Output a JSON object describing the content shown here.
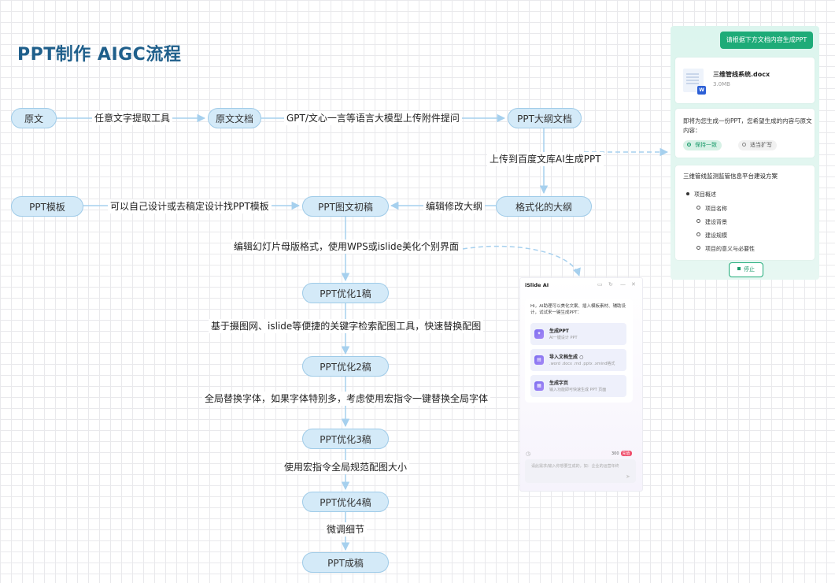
{
  "title": "PPT制作  AIGC流程",
  "nodes": {
    "yuanwen": "原文",
    "yuanwen_doc": "原文文档",
    "ppt_outline_doc": "PPT大纲文档",
    "formatted_outline": "格式化的大纲",
    "ppt_template": "PPT模板",
    "ppt_first_draft": "PPT图文初稿",
    "opt1": "PPT优化1稿",
    "opt2": "PPT优化2稿",
    "opt3": "PPT优化3稿",
    "opt4": "PPT优化4稿",
    "final": "PPT成稿"
  },
  "edges": {
    "e1": "任意文字提取工具",
    "e2": "GPT/文心一言等语言大模型上传附件提问",
    "e3": "上传到百度文库AI生成PPT",
    "e4": "编辑修改大纲",
    "e5": "可以自己设计或去稿定设计找PPT模板",
    "e6": "编辑幻灯片母版格式，使用WPS或islide美化个别界面",
    "e7": "基于摄图网、islide等便捷的关键字检索配图工具，快速替换配图",
    "e8": "全局替换字体，如果字体特别多，考虑使用宏指令一键替换全局字体",
    "e9": "使用宏指令全局规范配图大小",
    "e10": "微调细节"
  },
  "wenku_panel": {
    "top_button": "请根据下方文档内容生成PPT",
    "file_name": "三维管线系统.docx",
    "file_size": "3.0MB",
    "file_badge": "W",
    "ask_text": "即将为您生成一份PPT，您希望生成的内容与原文内容：",
    "option_keep": "保持一致",
    "option_expand": "适当扩写",
    "outline_title": "三维管线监测监管信息平台建设方案",
    "outline_items": [
      "项目概述",
      "项目名称",
      "建设背景",
      "建设规模",
      "项目的意义与必要性"
    ],
    "stop_button": "停止"
  },
  "islide_panel": {
    "header": "iSlide AI",
    "greeting": "Hi，AI助理可以美化文案、插入模板素材、辅助设计，试试来一键生成PPT：",
    "cards": [
      {
        "title": "生成PPT",
        "subtitle": "AI一键设计 PPT"
      },
      {
        "title": "导入文档生成 ○",
        "subtitle": ".word .docx .md .pptx .xmind格式"
      },
      {
        "title": "生成字页",
        "subtitle": "输入功能即可快速生成 PPT 页面"
      }
    ],
    "points": "300",
    "badge": "充值",
    "input_placeholder": "请此需求/输入你想要生成的，如：企业的运营年终"
  },
  "colors": {
    "node_fill": "#d4eaf8",
    "node_border": "#9fcbe8",
    "connector": "#a6d0ee",
    "title": "#1f5f8b",
    "wenku_green": "#1eab78"
  }
}
